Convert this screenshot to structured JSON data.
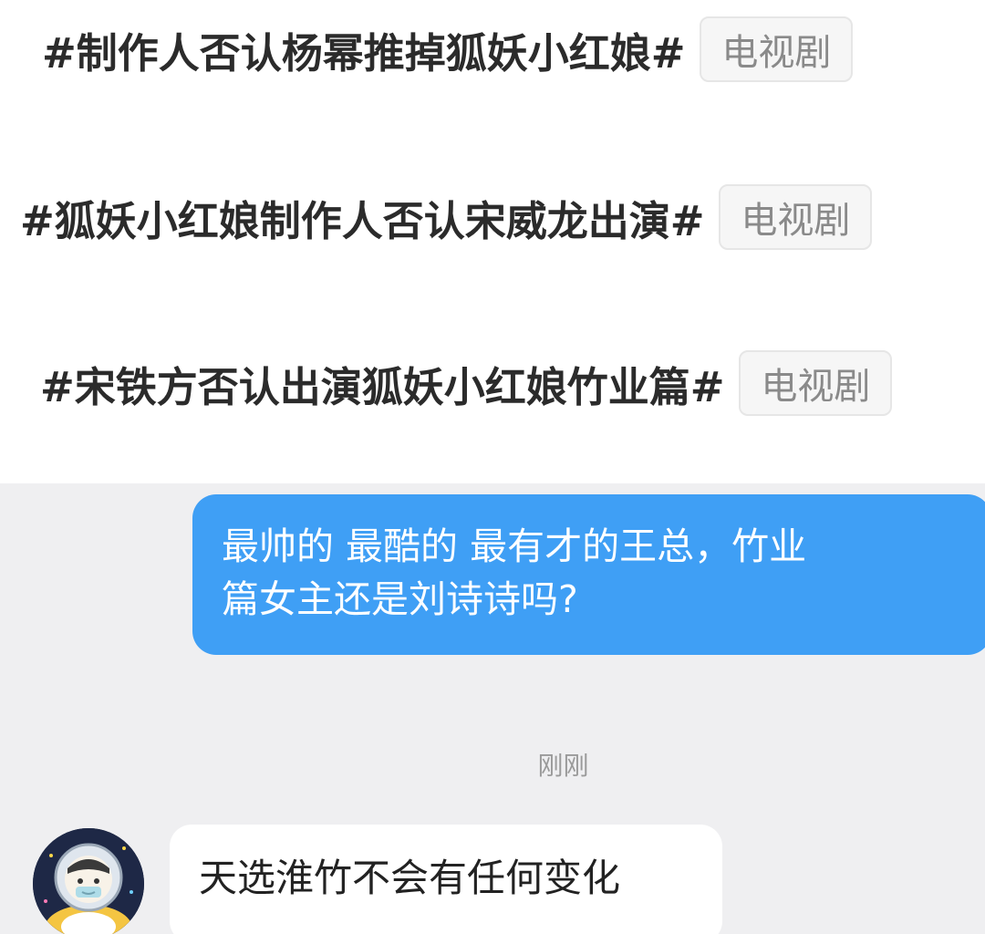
{
  "topics": [
    {
      "title": "#制作人否认杨幂推掉狐妖小红娘#",
      "tag": "电视剧"
    },
    {
      "title": "#狐妖小红娘制作人否认宋威龙出演#",
      "tag": "电视剧"
    },
    {
      "title": "#宋铁方否认出演狐妖小红娘竹业篇#",
      "tag": "电视剧"
    }
  ],
  "chat": {
    "outgoing_message_line1": "最帅的 最酷的 最有才的王总，竹业",
    "outgoing_message_line2": "篇女主还是刘诗诗吗?",
    "timestamp": "刚刚",
    "incoming_message": "天选淮竹不会有任何变化",
    "avatar_icon": "astronaut-avatar-icon"
  },
  "colors": {
    "outgoing_bubble": "#3f9ff5",
    "chat_background": "#efeff1",
    "tag_background": "#f6f6f6"
  }
}
